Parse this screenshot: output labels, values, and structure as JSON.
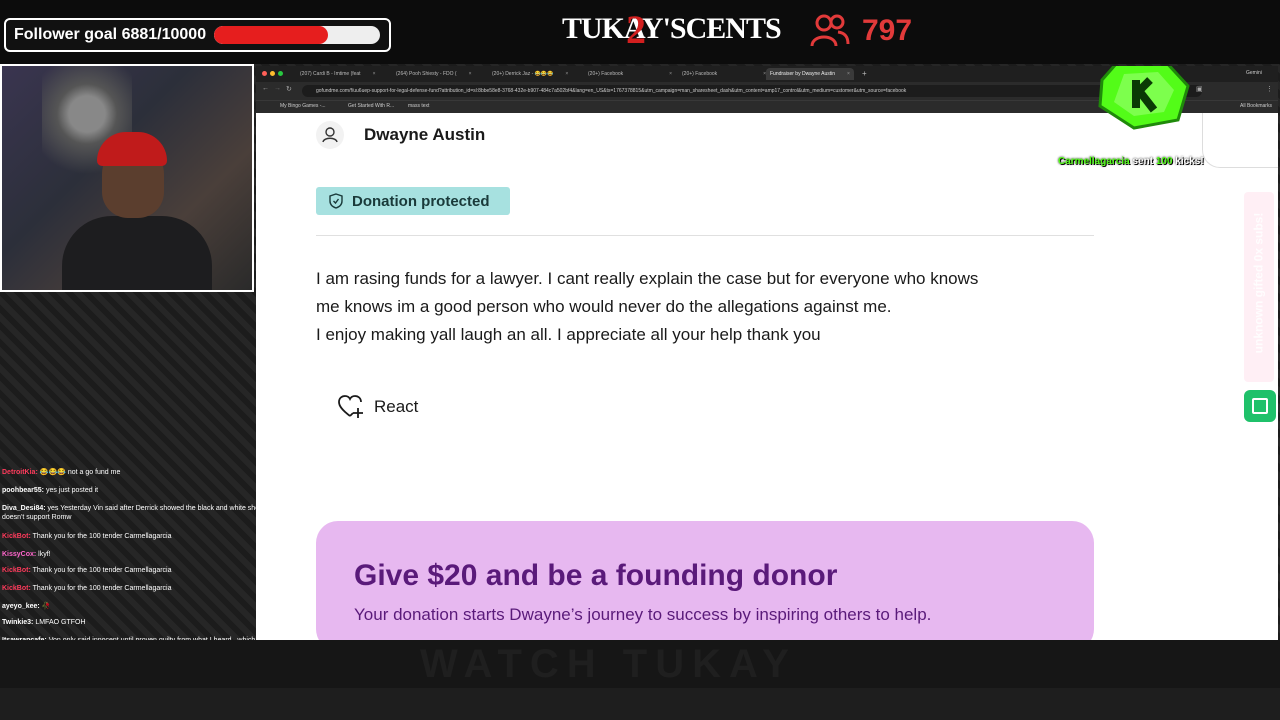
{
  "overlay": {
    "follower_goal_label": "Follower goal 6881/10000",
    "follower_goal_progress": 0.6881,
    "logo_left": "TUKAY'S",
    "logo_num": "2",
    "logo_right": "CENTS",
    "viewer_count": "797",
    "accent_color": "#e23a3a",
    "bottom_watermark": "WATCH TUKAY"
  },
  "chat": [
    {
      "user": "DetroitKia:",
      "text": " 😂😂😂 not a go fund me",
      "color": "#ff3b5c"
    },
    {
      "user": "poohbear55:",
      "text": " yes just posted it",
      "color": "#ffffff"
    },
    {
      "user": "Diva_Desi84:",
      "text": " yes Yesterday Vin said after Derrick showed the black and white she doesn't support Romw",
      "color": "#ffffff"
    },
    {
      "user": "KickBot:",
      "text": " Thank you for the 100 tender Carmellagarcia",
      "color": "#ff3b5c"
    },
    {
      "user": "KissyCox:",
      "text": " lkyf!",
      "color": "#ff66cc"
    },
    {
      "user": "KickBot:",
      "text": " Thank you for the 100 tender Carmellagarcia",
      "color": "#ff3b5c"
    },
    {
      "user": "KickBot:",
      "text": " Thank you for the 100 tender Carmellagarcia",
      "color": "#ff3b5c"
    },
    {
      "user": "ayeyo_kee:",
      "text": " 🥀",
      "color": "#ffffff"
    },
    {
      "user": "Twinkie3:",
      "text": " LMFAO GTFOH",
      "color": "#ffffff"
    },
    {
      "user": "Itsawrapcafe:",
      "text": " Von only said innocent until proven guilty from what I heard.. which is true... BUT my thing is FAWK the new case why is yall overlooking the old case!? smfh",
      "color": "#ffffff"
    }
  ],
  "browser": {
    "tabs": [
      "(207) Cardi B - Imtime (feat",
      "(264) Pooh Shiesty - FDO (",
      "(20+) Derrick Jaz - 😂😂😂",
      "(20+) Facebook",
      "(20+) Facebook",
      "Fundraiser by Dwayne Austin"
    ],
    "gemini_label": "Gemini",
    "url": "gofundme.com/f/uu6uep-support-for-legal-defense-fund?attribution_id=sl:8bbe58e8-3768-432e-b907-484c7a502bf4&lang=en_US&ts=1767378815&utm_campaign=man_sharesheet_dash&utm_content=amp17_control&utm_medium=customer&utm_source=facebook",
    "bookmarks": [
      "My Bingo Games -...",
      "Get Started With R...",
      "mass text"
    ],
    "all_bookmarks": "All Bookmarks"
  },
  "page": {
    "organizer_name": "Dwayne Austin",
    "badge_label": "Donation protected",
    "story_lines": [
      "I am rasing funds for a lawyer. I cant really explain the case but for everyone who knows",
      "me knows im a good person who would never do the allegations against me.",
      "I enjoy making yall laugh an all. I appreciate all your help thank you"
    ],
    "react_label": "React",
    "promo_title": "Give $20 and be a founding donor",
    "promo_sub": "Your donation starts Dwayne’s journey to success by inspiring others to help."
  },
  "alerts": {
    "kick_user": "Carmellagarcia",
    "kick_mid": " sent ",
    "kick_amount": "100",
    "kick_end": " kicks!",
    "side_subs": "unknown gifted 0x subs!"
  }
}
